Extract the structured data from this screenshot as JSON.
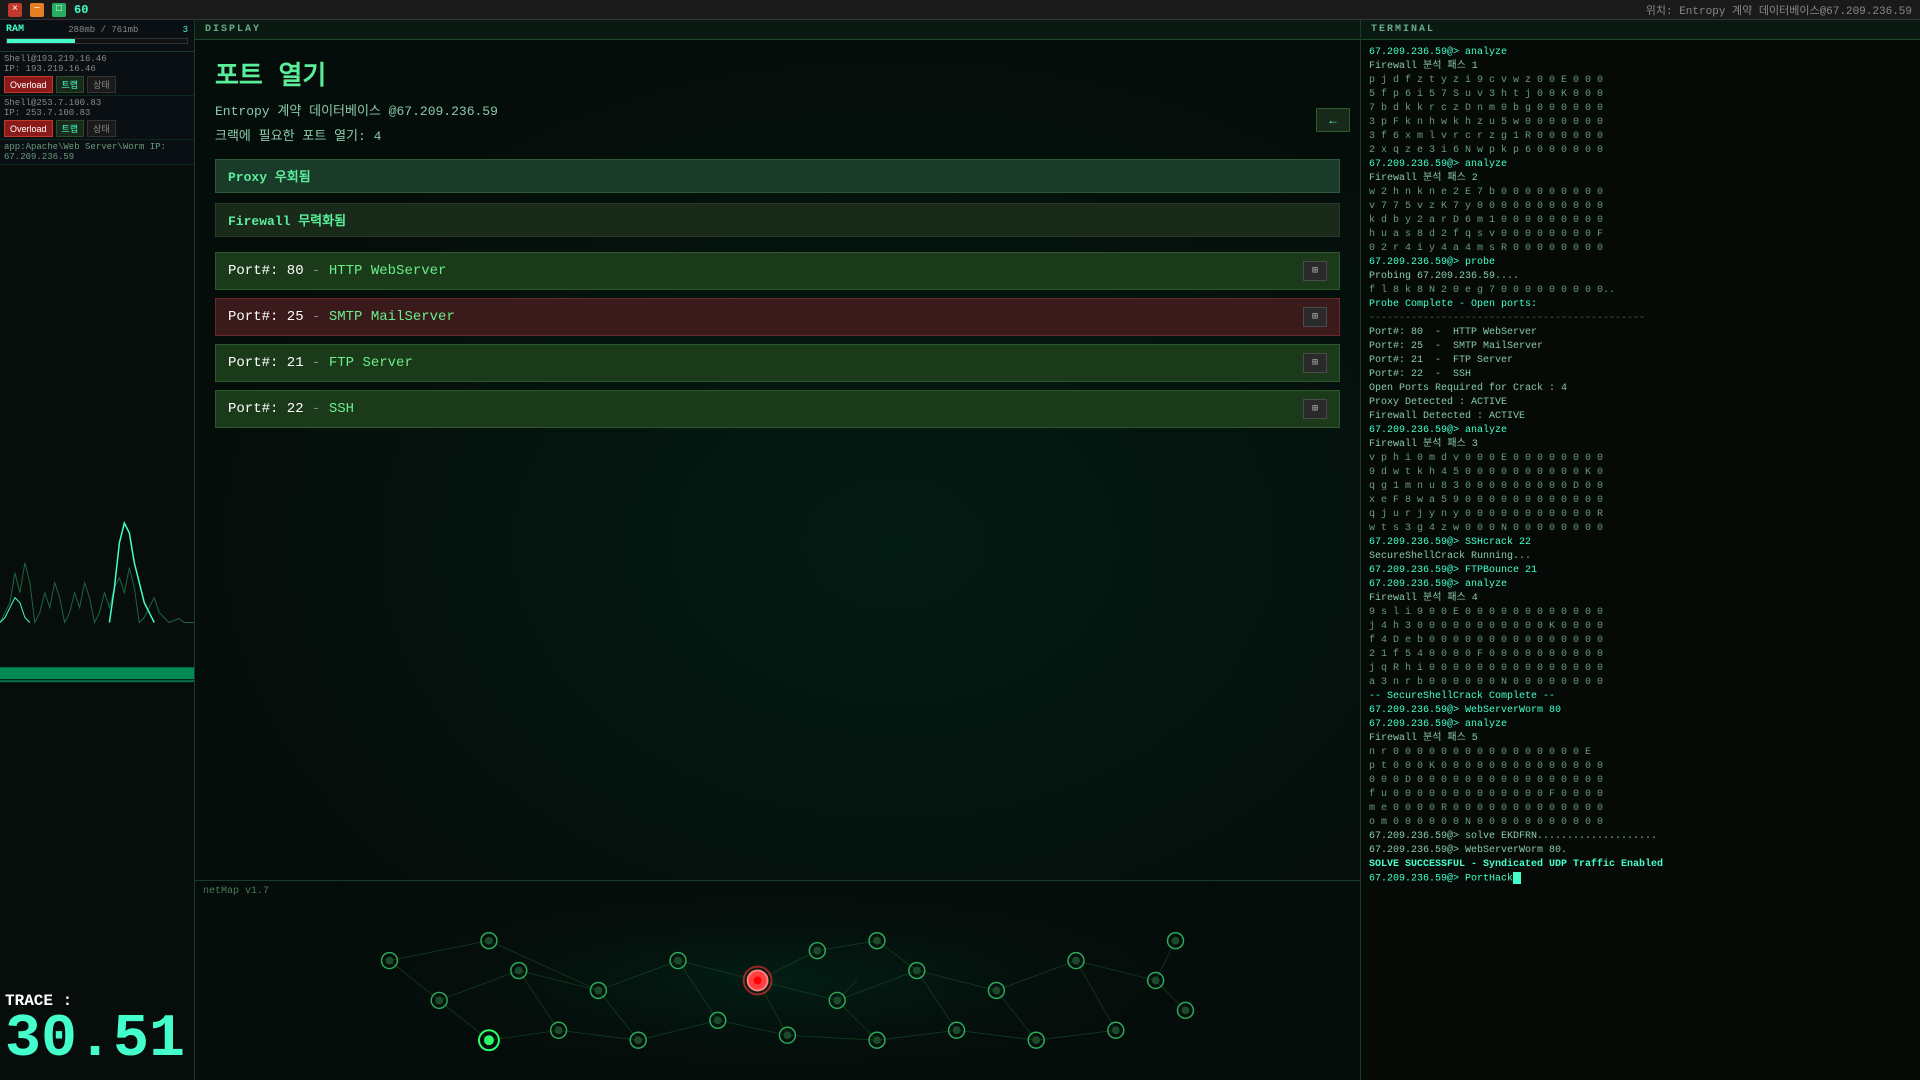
{
  "topbar": {
    "close_icon": "×",
    "min_icon": "−",
    "max_icon": "□",
    "counter": "60",
    "status_text": "위치: Entropy 계약 데이터베이스@67.209.236.59"
  },
  "left_panel": {
    "ram_label": "RAM",
    "ram_used": "288mb",
    "ram_total": "761mb",
    "ram_percent": 38,
    "connections": [
      {
        "name": "Shell@193.219.16.46",
        "ip": "IP: 193.219.16.46",
        "buttons": [
          "Overload",
          "트랩",
          "상태"
        ]
      },
      {
        "name": "Shell@253.7.100.83",
        "ip": "IP: 253.7.100.83",
        "buttons": [
          "Overload",
          "트랩",
          "상태"
        ]
      }
    ],
    "app_label": "app:Apache\\Web Server\\Worm IP: 67.209.236.59"
  },
  "display": {
    "header": "DISPLAY",
    "title": "포트 열기",
    "target": "Entropy 계약 데이터베이스 @67.209.236.59",
    "crack_info": "크랙에 필요한 포트 열기: 4",
    "proxy_label": "Proxy 우회됨",
    "firewall_label": "Firewall 무력화됨",
    "ports": [
      {
        "number": "80",
        "dash": " - ",
        "service": "HTTP WebServer",
        "selected": false
      },
      {
        "number": "25",
        "dash": " - ",
        "service": "SMTP MailServer",
        "selected": true
      },
      {
        "number": "21",
        "dash": " - ",
        "service": "FTP Server",
        "selected": false
      },
      {
        "number": "22",
        "dash": " - ",
        "service": "SSH",
        "selected": false
      }
    ],
    "back_button": "←",
    "netmap_label": "netMap v1.7"
  },
  "trace": {
    "label": "TRACE :",
    "value": "30.51"
  },
  "terminal": {
    "header": "TERMINAL",
    "lines": [
      {
        "type": "cmd",
        "text": "67.209.236.59@> analyze"
      },
      {
        "type": "result",
        "text": "Firewall 분석 패스 1"
      },
      {
        "type": "data",
        "text": "p j d f z t y z i 9 c v w z 0 0 E 0 0 0"
      },
      {
        "type": "data",
        "text": "5 f p 6 i 5 7 S u v 3 h t j 0 0 K 0 0 0"
      },
      {
        "type": "data",
        "text": "7 b d k k r c z D n m 0 b g 0 0 0 0 0 0"
      },
      {
        "type": "data",
        "text": "3 p F k n h w k h z u 5 w 0 0 0 0 0 0 0"
      },
      {
        "type": "data",
        "text": "3 f 6 x m l v r c r z g 1 R 0 0 0 0 0 0"
      },
      {
        "type": "data",
        "text": "2 x q z e 3 i 6 N w p k p 6 0 0 0 0 0 0"
      },
      {
        "type": "cmd",
        "text": "67.209.236.59@> analyze"
      },
      {
        "type": "result",
        "text": "Firewall 분석 패스 2"
      },
      {
        "type": "separator",
        "text": ""
      },
      {
        "type": "data",
        "text": "w 2 h n k n e 2 E 7 b 0 0 0 0 0 0 0 0 0"
      },
      {
        "type": "data",
        "text": "v 7 7 5 v z K 7 y 0 0 0 0 0 0 0 0 0 0 0"
      },
      {
        "type": "data",
        "text": "k d b y 2 a r D 6 m 1 0 0 0 0 0 0 0 0 0"
      },
      {
        "type": "data",
        "text": "h u a s 8 d 2 f q s v 0 0 0 0 0 0 0 0 F"
      },
      {
        "type": "data",
        "text": "0 2 r 4 i y 4 a 4 m s R 0 0 0 0 0 0 0 0"
      },
      {
        "type": "cmd",
        "text": "67.209.236.59@> probe"
      },
      {
        "type": "result",
        "text": "Probing 67.209.236.59...."
      },
      {
        "type": "data",
        "text": "f l 8 k 8 N 2 0 e g 7 0 0 0 0 0 0 0 0 0.."
      },
      {
        "type": "separator",
        "text": ""
      },
      {
        "type": "highlight",
        "text": "Probe Complete - Open ports:"
      },
      {
        "type": "separator",
        "text": "----------------------------------------------"
      },
      {
        "type": "result",
        "text": "Port#: 80  -  HTTP WebServer"
      },
      {
        "type": "result",
        "text": "Port#: 25  -  SMTP MailServer"
      },
      {
        "type": "result",
        "text": "Port#: 21  -  FTP Server"
      },
      {
        "type": "result",
        "text": "Port#: 22  -  SSH"
      },
      {
        "type": "separator",
        "text": ""
      },
      {
        "type": "result",
        "text": "Open Ports Required for Crack : 4"
      },
      {
        "type": "result",
        "text": "Proxy Detected : ACTIVE"
      },
      {
        "type": "result",
        "text": "Firewall Detected : ACTIVE"
      },
      {
        "type": "cmd",
        "text": "67.209.236.59@> analyze"
      },
      {
        "type": "result",
        "text": "Firewall 분석 패스 3"
      },
      {
        "type": "separator",
        "text": ""
      },
      {
        "type": "data",
        "text": "v p h i 0 m d v 0 0 0 E 0 0 0 0 0 0 0 0"
      },
      {
        "type": "data",
        "text": "9 d w t k h 4 5 0 0 0 0 0 0 0 0 0 0 K 0"
      },
      {
        "type": "data",
        "text": "q g 1 m n u 8 3 0 0 0 0 0 0 0 0 0 D 0 0"
      },
      {
        "type": "data",
        "text": "x e F 8 w a 5 9 0 0 0 0 0 0 0 0 0 0 0 0"
      },
      {
        "type": "data",
        "text": "q j u r j y n y 0 0 0 0 0 0 0 0 0 0 0 R"
      },
      {
        "type": "data",
        "text": "w t s 3 g 4 z w 0 0 0 N 0 0 0 0 0 0 0 0"
      },
      {
        "type": "separator",
        "text": ""
      },
      {
        "type": "cmd",
        "text": "67.209.236.59@> SSHcrack 22"
      },
      {
        "type": "result",
        "text": "SecureShellCrack Running..."
      },
      {
        "type": "cmd",
        "text": "67.209.236.59@> FTPBounce 21"
      },
      {
        "type": "cmd",
        "text": "67.209.236.59@> analyze"
      },
      {
        "type": "result",
        "text": "Firewall 분석 패스 4"
      },
      {
        "type": "separator",
        "text": ""
      },
      {
        "type": "data",
        "text": "9 s l i 9 0 0 E 0 0 0 0 0 0 0 0 0 0 0 0"
      },
      {
        "type": "data",
        "text": "j 4 h 3 0 0 0 0 0 0 0 0 0 0 0 K 0 0 0 0"
      },
      {
        "type": "data",
        "text": "f 4 D e b 0 0 0 0 0 0 0 0 0 0 0 0 0 0 0"
      },
      {
        "type": "data",
        "text": "2 1 f 5 4 0 0 0 0 F 0 0 0 0 0 0 0 0 0 0"
      },
      {
        "type": "data",
        "text": "j q R h i 0 0 0 0 0 0 0 0 0 0 0 0 0 0 0"
      },
      {
        "type": "data",
        "text": "a 3 n r b 0 0 0 0 0 0 N 0 0 0 0 0 0 0 0"
      },
      {
        "type": "separator",
        "text": ""
      },
      {
        "type": "highlight",
        "text": "-- SecureShellCrack Complete --"
      },
      {
        "type": "cmd",
        "text": "67.209.236.59@> WebServerWorm 80"
      },
      {
        "type": "cmd",
        "text": "67.209.236.59@> analyze"
      },
      {
        "type": "result",
        "text": "Firewall 분석 패스 5"
      },
      {
        "type": "separator",
        "text": ""
      },
      {
        "type": "data",
        "text": "n r 0 0 0 0 0 0 0 0 0 0 0 0 0 0 0 0 E"
      },
      {
        "type": "data",
        "text": "p t 0 0 0 K 0 0 0 0 0 0 0 0 0 0 0 0 0 0"
      },
      {
        "type": "data",
        "text": "0 0 0 D 0 0 0 0 0 0 0 0 0 0 0 0 0 0 0 0"
      },
      {
        "type": "data",
        "text": "f u 0 0 0 0 0 0 0 0 0 0 0 0 0 F 0 0 0 0"
      },
      {
        "type": "data",
        "text": "m e 0 0 0 0 R 0 0 0 0 0 0 0 0 0 0 0 0 0"
      },
      {
        "type": "data",
        "text": "o m 0 0 0 0 0 0 N 0 0 0 0 0 0 0 0 0 0 0"
      },
      {
        "type": "separator",
        "text": ""
      },
      {
        "type": "result",
        "text": "67.209.236.59@> solve EKDFRN...................."
      },
      {
        "type": "result",
        "text": "67.209.236.59@> WebServerWorm 80."
      },
      {
        "type": "success",
        "text": "SOLVE SUCCESSFUL - Syndicated UDP Traffic Enabled"
      },
      {
        "type": "separator",
        "text": ""
      },
      {
        "type": "cmd",
        "text": "67.209.236.59@> PortHack"
      }
    ]
  }
}
